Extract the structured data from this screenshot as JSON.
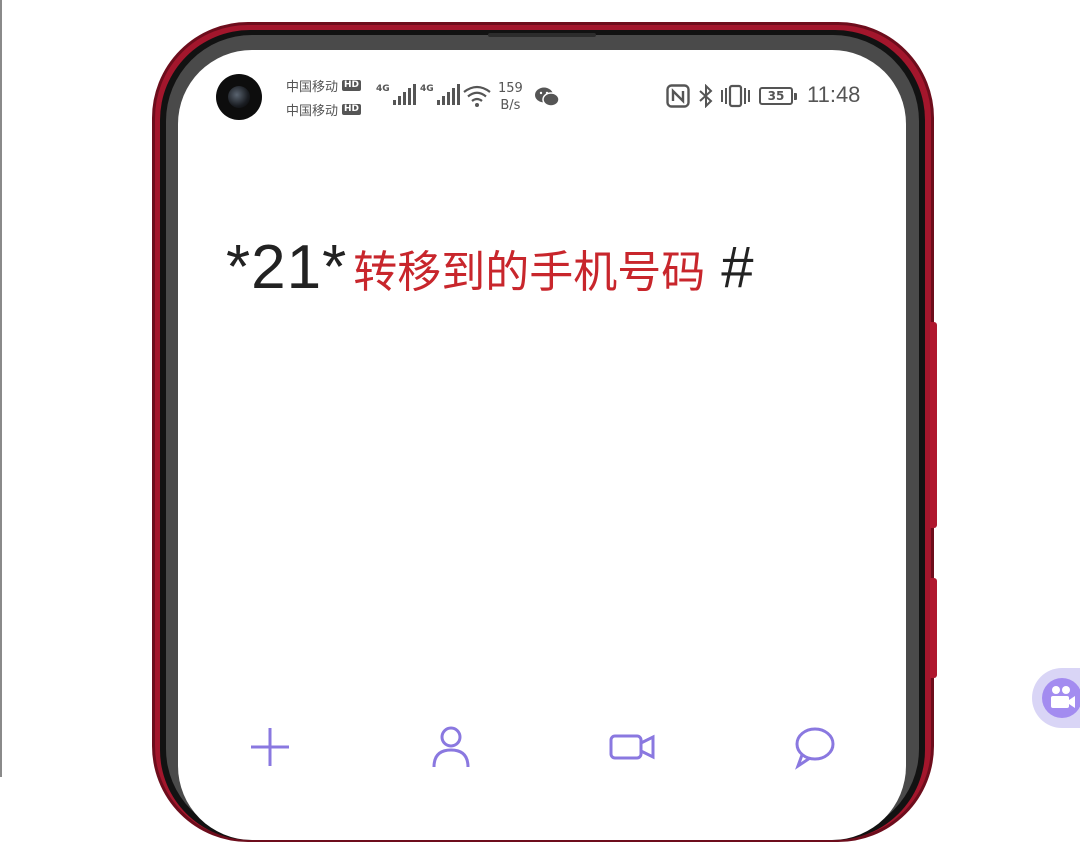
{
  "status_bar": {
    "carrier_1": "中国移动",
    "carrier_2": "中国移动",
    "hd_badge": "HD",
    "network_type": "4G",
    "network_speed_value": "159",
    "network_speed_unit": "B/s",
    "battery_level": "35",
    "time": "11:48",
    "icons": [
      "camera-cutout",
      "signal-icon",
      "wifi-icon",
      "wechat-icon",
      "nfc-icon",
      "bluetooth-icon",
      "vibrate-icon",
      "battery-icon"
    ]
  },
  "dialer": {
    "prefix": "*21*",
    "target_text": "转移到的手机号码",
    "suffix": "#",
    "prefix_color": "#222222",
    "target_color": "#c8262c"
  },
  "toolbar": {
    "icons": [
      "add-icon",
      "contact-icon",
      "video-call-icon",
      "message-icon"
    ],
    "accent_color": "#8a78e0"
  },
  "floating_button": {
    "icon": "video-camera-icon",
    "color": "#a38cf0"
  },
  "device": {
    "frame_color": "#a3162c"
  }
}
